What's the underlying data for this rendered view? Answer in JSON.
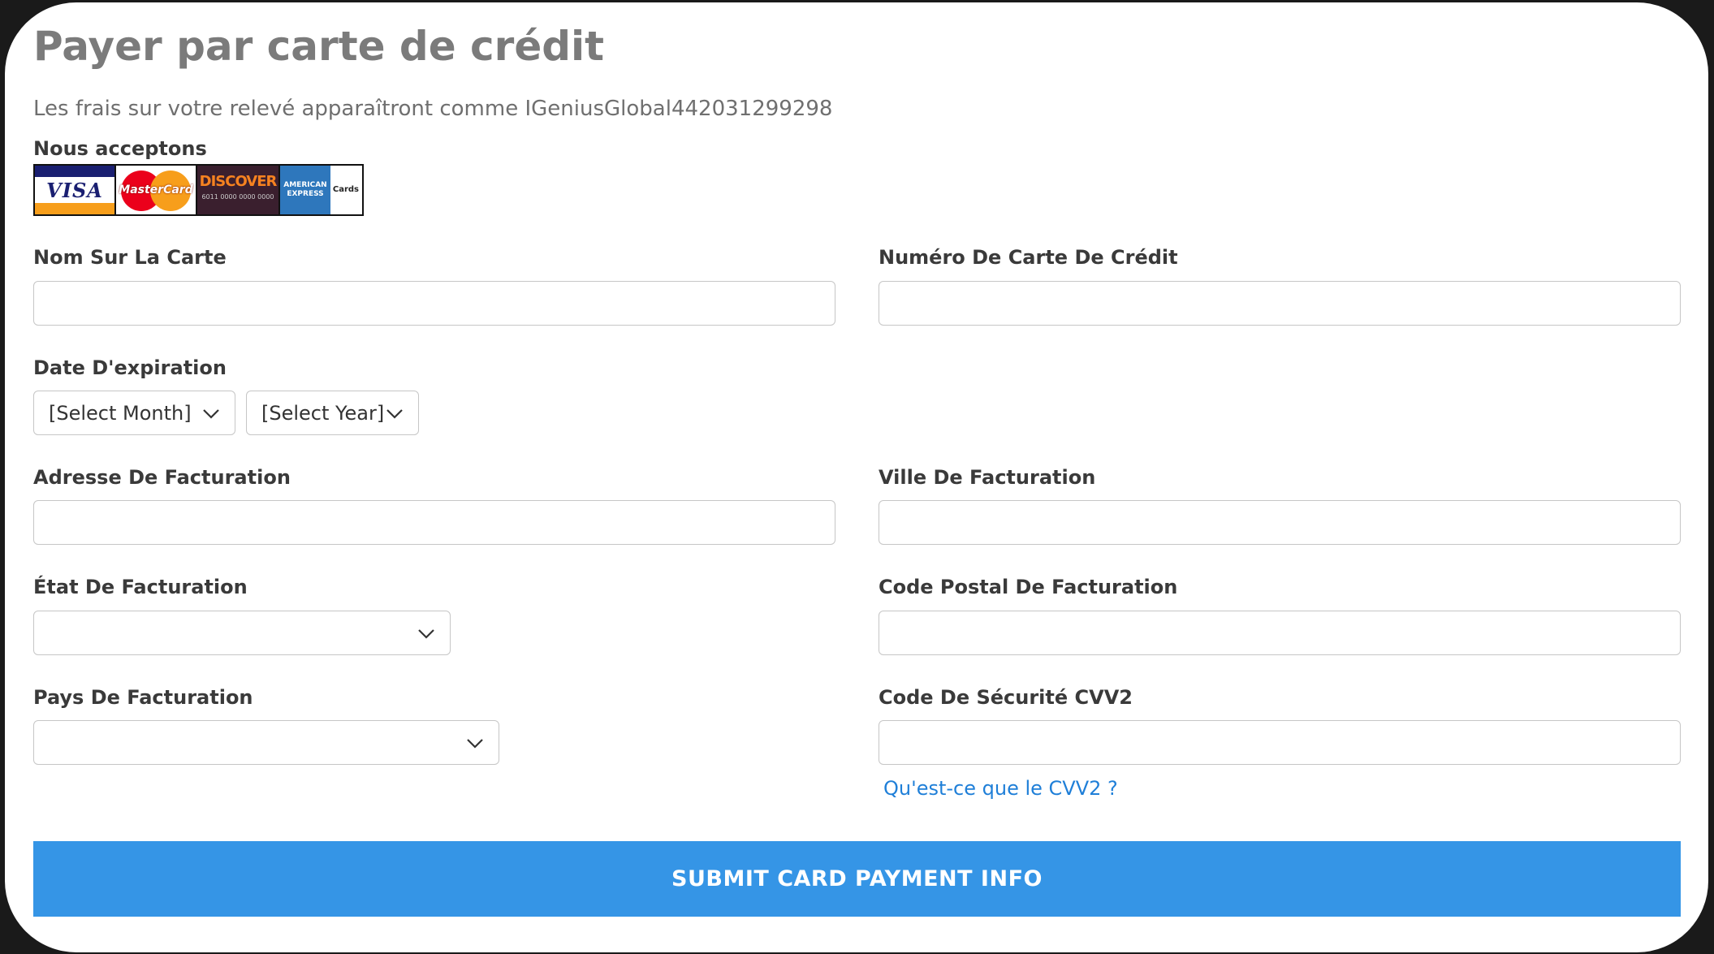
{
  "page": {
    "title": "Payer par carte de crédit",
    "statement_note": "Les frais sur votre relevé apparaîtront comme IGeniusGlobal442031299298",
    "accept_label": "Nous acceptons"
  },
  "card_logos": {
    "visa": "VISA",
    "mastercard": "MasterCard",
    "discover": "DISCOVER",
    "amex_brand": "AMERICAN EXPRESS",
    "amex_suffix": "Cards"
  },
  "form": {
    "name_on_card": {
      "label": "Nom Sur La Carte",
      "value": ""
    },
    "card_number": {
      "label": "Numéro De Carte De Crédit",
      "value": ""
    },
    "expiration": {
      "label": "Date D'expiration",
      "month_selected": "[Select Month]",
      "year_selected": "[Select Year]"
    },
    "billing_address": {
      "label": "Adresse De Facturation",
      "value": ""
    },
    "billing_city": {
      "label": "Ville De Facturation",
      "value": ""
    },
    "billing_state": {
      "label": "État De Facturation",
      "selected": ""
    },
    "billing_zip": {
      "label": "Code Postal De Facturation",
      "value": ""
    },
    "billing_country": {
      "label": "Pays De Facturation",
      "selected": ""
    },
    "cvv": {
      "label": "Code De Sécurité CVV2",
      "value": "",
      "help_link": "Qu'est-ce que le CVV2 ?"
    }
  },
  "submit": {
    "label": "SUBMIT CARD PAYMENT INFO"
  },
  "colors": {
    "submit_bg": "#3595e6",
    "link": "#1f7fd8",
    "title": "#7b7b7b",
    "input_border": "#c6c6c6"
  }
}
